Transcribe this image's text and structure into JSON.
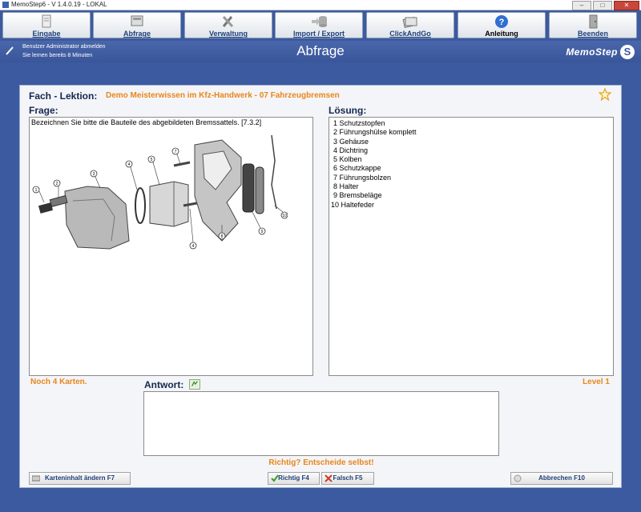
{
  "window": {
    "title": "MemoStep6 - V 1.4.0.19  -  LOKAL",
    "controls": [
      "–",
      "□",
      "✕"
    ]
  },
  "toolbar": {
    "buttons": [
      {
        "label": "Eingabe",
        "icon": "document-icon"
      },
      {
        "label": "Abfrage",
        "icon": "card-query-icon"
      },
      {
        "label": "Verwaltung",
        "icon": "tools-icon"
      },
      {
        "label": "Import / Export",
        "icon": "database-icon"
      },
      {
        "label": "ClickAndGo",
        "icon": "cards-icon"
      },
      {
        "label": "Anleitung",
        "icon": "help-icon"
      },
      {
        "label": "Beenden",
        "icon": "exit-door-icon"
      }
    ]
  },
  "status": {
    "user": "Benutzer Administrator abmelden",
    "time": "Sie lernen bereits 8 Minuten",
    "page_title": "Abfrage",
    "logo": "MemoStep",
    "logo_mark": "S"
  },
  "lesson": {
    "label": "Fach - Lektion:",
    "value": "Demo Meisterwissen im Kfz-Handwerk - 07 Fahrzeugbremsen"
  },
  "question": {
    "label": "Frage:",
    "text": "Bezeichnen Sie bitte die Bauteile des abgebildeten Bremssattels. [7.3.2]"
  },
  "diagram": {
    "numbers": [
      "1",
      "2",
      "3",
      "4",
      "5",
      "7",
      "4",
      "8",
      "9",
      "10"
    ]
  },
  "solution": {
    "label": "Lösung:",
    "items": [
      "1 Schutzstopfen",
      "2 Führungshülse komplett",
      "3 Gehäuse",
      "4 Dichtring",
      "5 Kolben",
      "6 Schutzkappe",
      "7 Führungsbolzen",
      "8 Halter",
      "9 Bremsbeläge",
      "10 Haltefeder"
    ]
  },
  "remaining": "Noch 4 Karten.",
  "level": "Level 1",
  "answer": {
    "label": "Antwort:",
    "value": ""
  },
  "hint": "Richtig? Entscheide selbst!",
  "buttons": {
    "edit": "Karteninhalt ändern  F7",
    "correct": "Richtig  F4",
    "wrong": "Falsch  F5",
    "cancel": "Abbrechen  F10"
  },
  "colors": {
    "accent": "#3c5a9f",
    "highlight": "#e8861a",
    "heading": "#14284e"
  }
}
